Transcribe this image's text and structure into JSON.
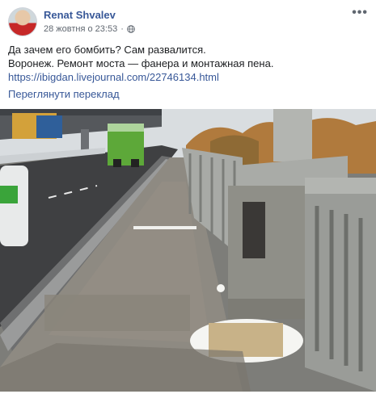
{
  "post": {
    "author": "Renat Shvalev",
    "date": "28 жовтня о 23:53",
    "privacy_icon": "globe-icon",
    "more_icon": "more-horizontal-icon",
    "text_line_1": "Да зачем его бомбить? Сам развалится.",
    "text_line_2": "Воронеж. Ремонт моста — фанера и монтажная пена.",
    "link": "https://ibigdan.livejournal.com/22746134.html",
    "translate_label": "Переглянути переклад"
  },
  "photo": {
    "subject": "bridge-sidewalk-photo",
    "colors": {
      "sky": "#d9dde0",
      "asphalt": "#3f4042",
      "sidewalk": "#8e8a82",
      "railing": "#9a9c98",
      "foam": "#f5f5f2",
      "plywood": "#c8b288",
      "bus_green": "#5da839"
    }
  }
}
